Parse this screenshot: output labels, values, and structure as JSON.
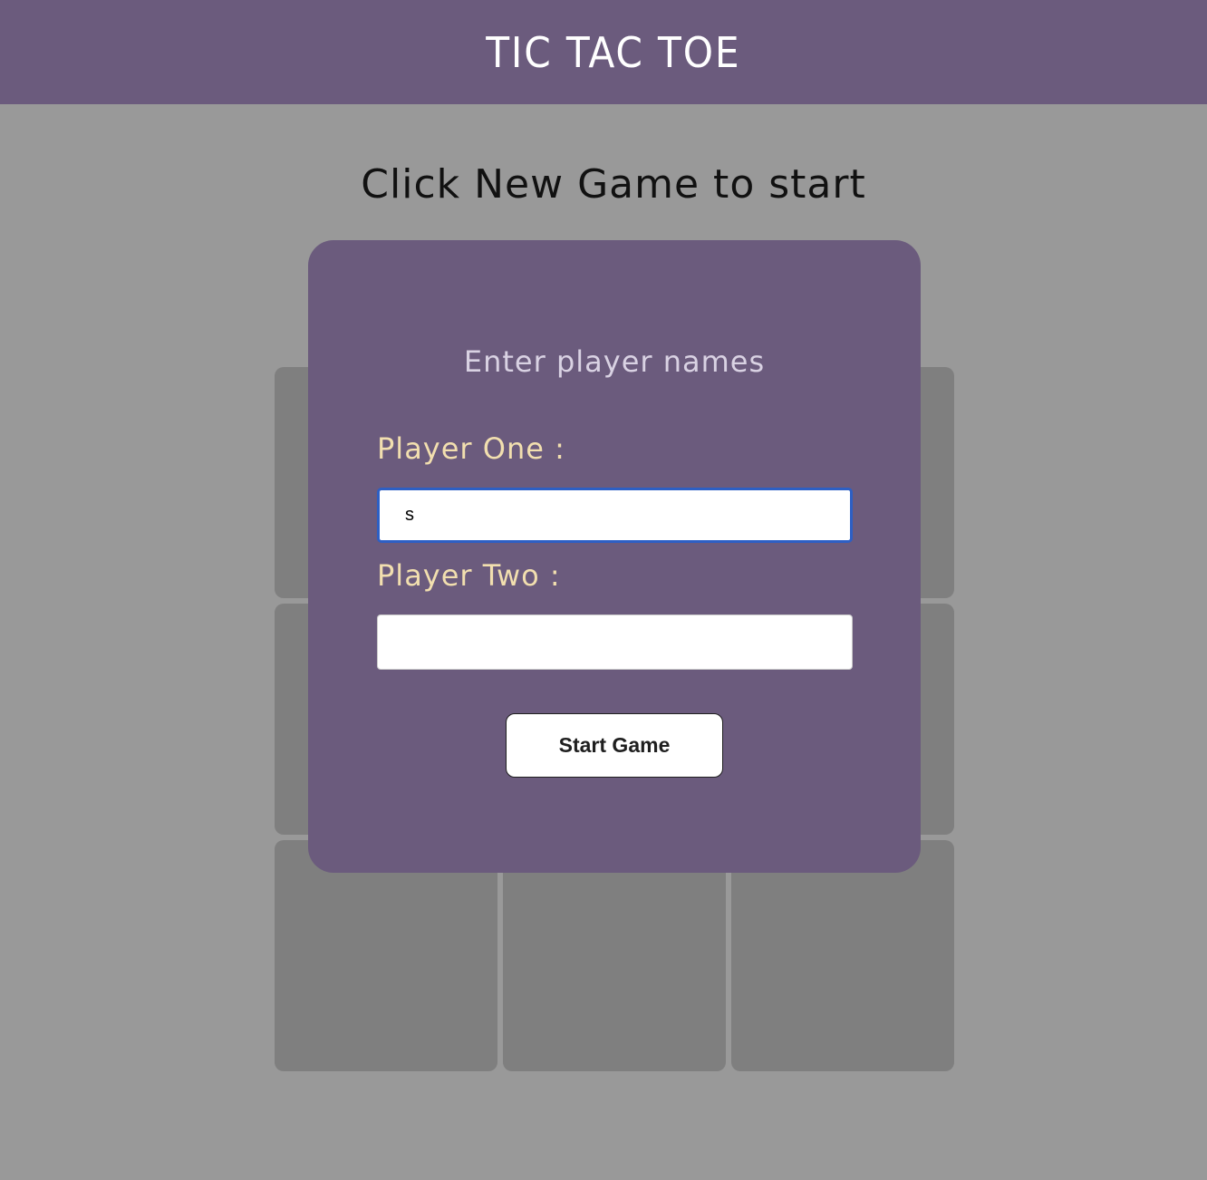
{
  "header": {
    "title": "TIC TAC TOE"
  },
  "status": {
    "message": "Click New Game to start"
  },
  "board": {
    "cells": [
      "",
      "",
      "",
      "",
      "",
      "",
      "",
      "",
      ""
    ]
  },
  "modal": {
    "title": "Enter player names",
    "player_one_label": "Player One :",
    "player_one_value": "s",
    "player_two_label": "Player Two :",
    "player_two_value": "",
    "start_button_label": "Start Game"
  },
  "colors": {
    "header_bg": "#6b5b7d",
    "page_bg": "#999999",
    "cell_bg": "#7f7f7f",
    "modal_bg": "#6b5b7d",
    "label_color": "#f2dfaf",
    "modal_title_color": "#d9d2e3",
    "focus_border": "#2d5fc4"
  }
}
